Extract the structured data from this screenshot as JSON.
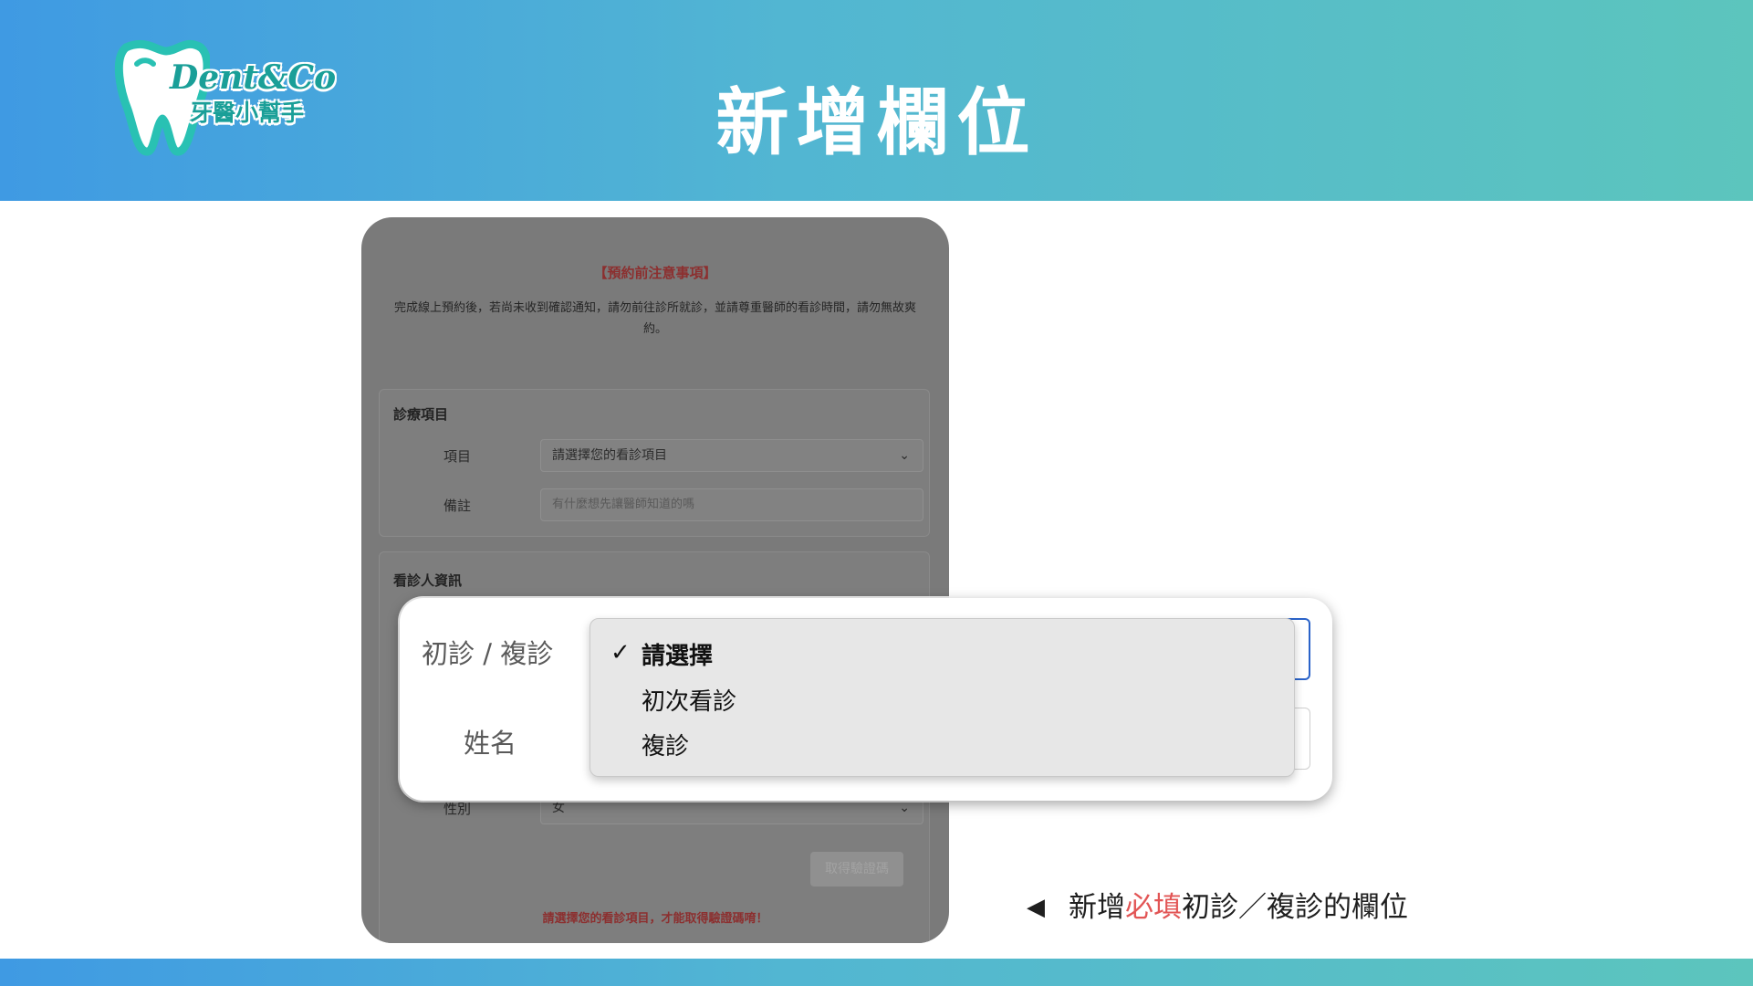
{
  "header": {
    "logo_script": "Dent&Co",
    "logo_cn": "牙醫小幫手",
    "title": "新增欄位"
  },
  "phone": {
    "notice_title": "【預約前注意事項】",
    "notice_text": "完成線上預約後，若尚未收到確認通知，請勿前往診所就診，並請尊重醫師的看診時間，請勿無故爽約。",
    "treatment_card": {
      "title": "診療項目",
      "item_label": "項目",
      "item_value": "請選擇您的看診項目",
      "note_label": "備註",
      "note_placeholder": "有什麼想先讓醫師知道的嗎"
    },
    "patient_card": {
      "title": "看診人資訊",
      "gender_label": "性別",
      "gender_value": "女",
      "code_button": "取得驗證碼",
      "warning": "請選擇您的看診項目，才能取得驗證碼唷！"
    }
  },
  "zoom": {
    "visit_type_label": "初診 / 複診",
    "name_label": "姓名",
    "options": [
      {
        "label": "請選擇",
        "selected": true
      },
      {
        "label": "初次看診",
        "selected": false
      },
      {
        "label": "複診",
        "selected": false
      }
    ]
  },
  "caption": {
    "prefix": "新增",
    "highlight": "必填",
    "suffix": "初診／複診的欄位"
  },
  "colors": {
    "header_start": "#3f9ae3",
    "header_end": "#5cc5bd",
    "highlight_red": "#e25555",
    "focus_blue": "#2a63c9"
  }
}
